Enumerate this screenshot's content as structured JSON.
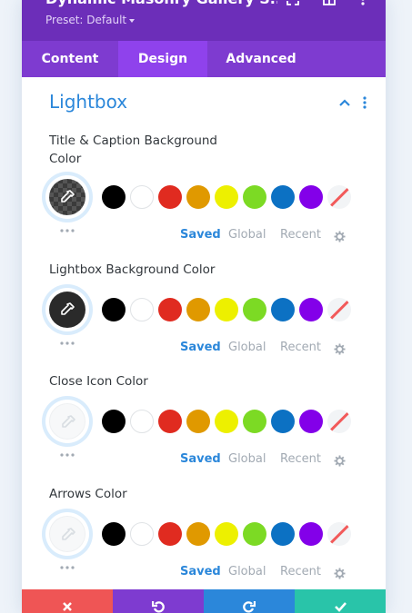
{
  "header": {
    "title": "Dynamic Masonry Gallery S...",
    "preset": "Preset: Default"
  },
  "tabs": [
    {
      "label": "Content"
    },
    {
      "label": "Design"
    },
    {
      "label": "Advanced"
    }
  ],
  "section": {
    "title": "Lightbox"
  },
  "options": {
    "saved": "Saved",
    "global": "Global",
    "recent": "Recent"
  },
  "groups": [
    {
      "label": "Title & Caption Background Color",
      "picker": "checker-dark"
    },
    {
      "label": "Lightbox Background Color",
      "picker": "solid-dark"
    },
    {
      "label": "Close Icon Color",
      "picker": "light"
    },
    {
      "label": "Arrows Color",
      "picker": "light"
    }
  ],
  "palette": [
    "#000000",
    "#ffffff",
    "#e02b20",
    "#e09900",
    "#edf000",
    "#7cda24",
    "#0c71c3",
    "#8300e9"
  ],
  "colors": {
    "header": "#6c2eb9",
    "tabs": "#7e3bd0",
    "tab_active": "#8f42ec",
    "accent": "#2b87da",
    "cancel": "#ef5555",
    "undo": "#7e3bd0",
    "redo": "#2b87da",
    "save": "#29c4a9"
  }
}
